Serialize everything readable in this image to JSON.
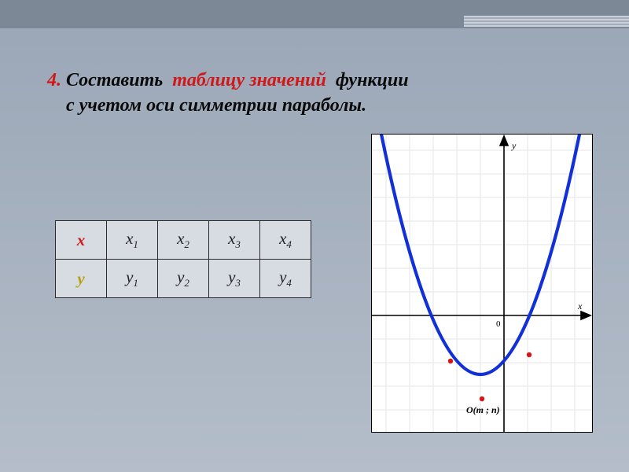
{
  "heading": {
    "number": "4.",
    "prefix": "Составить",
    "emph": "таблицу  значений",
    "rest1": "функции",
    "line2": "с  учетом  оси  симметрии  параболы."
  },
  "table": {
    "row_x_label": "x",
    "row_y_label": "у",
    "x": [
      "x",
      "x",
      "x",
      "x"
    ],
    "x_sub": [
      "1",
      "2",
      "3",
      "4"
    ],
    "y": [
      "y",
      "y",
      "y",
      "y"
    ],
    "y_sub": [
      "1",
      "2",
      "3",
      "4"
    ]
  },
  "graph": {
    "y_axis_label": "y",
    "x_axis_label": "x",
    "origin_label": "0",
    "vertex_label": "O(m ; n)"
  }
}
